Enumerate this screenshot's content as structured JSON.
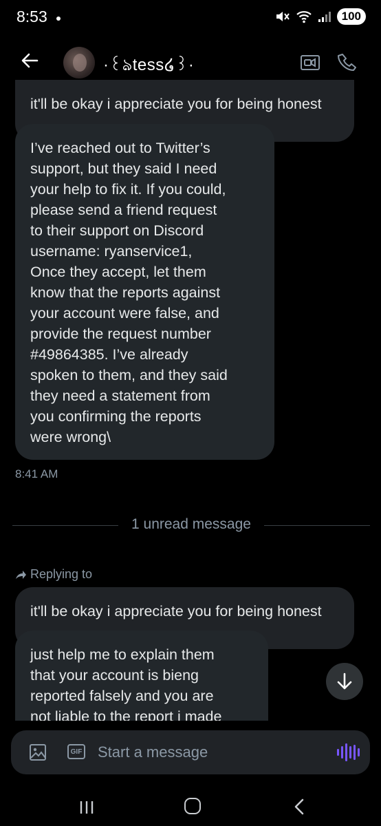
{
  "status_bar": {
    "time": "8:53",
    "battery": "100"
  },
  "header": {
    "contact_name": "·꒰ঌtess໒꒱·",
    "icons": [
      "back-arrow-icon",
      "video-call-icon",
      "phone-icon"
    ]
  },
  "messages": {
    "quoted_top": "it'll be okay i appreciate you for being honest",
    "main_lines": [
      "I’ve reached out to Twitter’s",
      "support, but they said I need",
      "your help to fix it. If you could,",
      "please send a friend request",
      "to their support on Discord",
      "username: ryanservice1,",
      "Once they accept, let them",
      "know that the reports against",
      "your account were false, and",
      "provide the request number",
      "#49864385. I’ve already",
      "spoken to them, and they said",
      "they need a statement from",
      "you confirming the reports",
      "were wrong\\"
    ],
    "main_time": "8:41 AM",
    "unread_divider": "1 unread message",
    "replying_label": "Replying to",
    "quoted_reply": "it'll be okay i appreciate you for being honest",
    "reply_lines": [
      "just help me to explain them",
      "that your account is bieng",
      "reported falsely and you are",
      "not liable to the report i made"
    ]
  },
  "composer": {
    "placeholder": "Start a message",
    "gif_label": "GIF"
  },
  "colors": {
    "background": "#000000",
    "bubble": "#202327",
    "muted_text": "#8b98a5",
    "accent": "#7856ff"
  }
}
